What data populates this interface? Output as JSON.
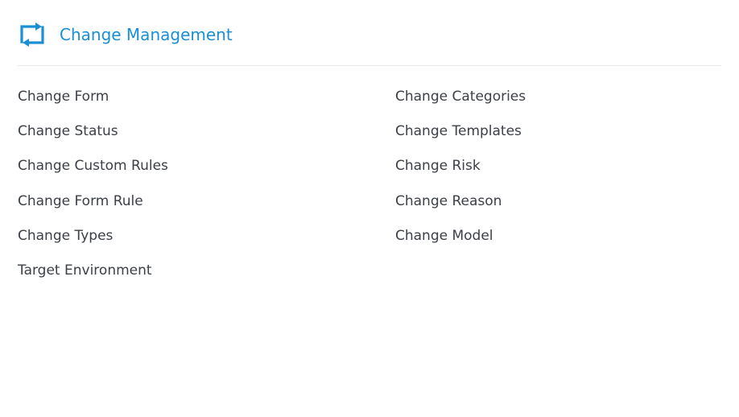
{
  "header": {
    "title": "Change Management",
    "icon": "repeat-icon",
    "accent_color": "#1a8fd6"
  },
  "colors": {
    "link_text": "#3b3f46",
    "divider": "#e7e9ed"
  },
  "links_left": [
    "Change Form",
    "Change Status",
    "Change Custom Rules",
    "Change Form Rule",
    "Change Types",
    "Target Environment"
  ],
  "links_right": [
    "Change Categories",
    "Change Templates",
    "Change Risk",
    "Change Reason",
    "Change Model"
  ]
}
